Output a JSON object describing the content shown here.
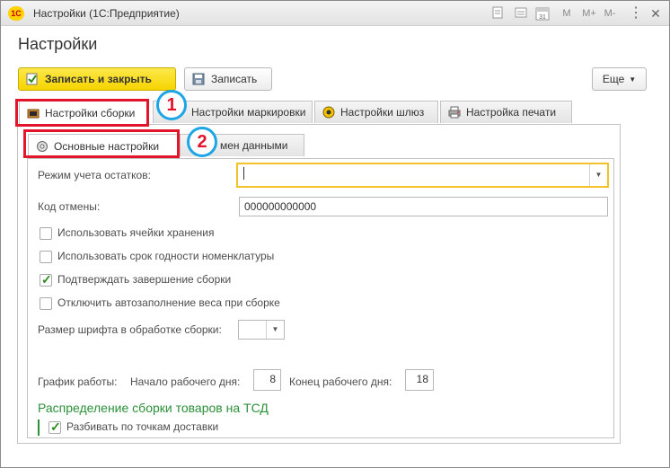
{
  "window": {
    "title": "Настройки (1С:Предприятие)",
    "logo_text": "1С",
    "m_label": "M",
    "mplus_label": "M+",
    "mminus_label": "M-",
    "calendar_day": "31"
  },
  "page": {
    "title": "Настройки"
  },
  "toolbar": {
    "save_close_label": "Записать и закрыть",
    "save_label": "Записать",
    "more_label": "Еще"
  },
  "tabs": [
    {
      "label": "Настройки сборки",
      "icon": "box-tools-icon",
      "active": true
    },
    {
      "label": "Настройки маркировки",
      "active": false
    },
    {
      "label": "Настройки шлюз",
      "icon": "gear-icon",
      "active": false
    },
    {
      "label": "Настройка печати",
      "icon": "printer-icon",
      "active": false
    }
  ],
  "subtabs": [
    {
      "label": "Основные настройки",
      "icon": "settings-icon",
      "active": true
    },
    {
      "label": "мен данными",
      "active": false
    }
  ],
  "form": {
    "stock_mode_label": "Режим учета остатков:",
    "stock_mode_value": "",
    "cancel_code_label": "Код отмены:",
    "cancel_code_value": "000000000000",
    "checkboxes": [
      {
        "label": "Использовать ячейки хранения",
        "checked": false
      },
      {
        "label": "Использовать срок годности номенклатуры",
        "checked": false
      },
      {
        "label": "Подтверждать завершение сборки",
        "checked": true
      },
      {
        "label": "Отключить автозаполнение веса при сборке",
        "checked": false
      }
    ],
    "font_size_label": "Размер шрифта в обработке сборки:",
    "font_size_value": "",
    "schedule_label": "График работы:",
    "start_label": "Начало рабочего дня:",
    "start_value": "8",
    "end_label": "Конец рабочего дня:",
    "end_value": "18",
    "section_title": "Распределение сборки товаров на ТСД",
    "split_label": "Разбивать по точкам доставки",
    "split_checked": true
  },
  "annotations": {
    "badge1": "1",
    "badge2": "2"
  },
  "colors": {
    "accent_yellow": "#f6d400",
    "annotation_red": "#e3152b",
    "annotation_blue": "#1ea5e6",
    "section_green": "#2c8f3a"
  }
}
